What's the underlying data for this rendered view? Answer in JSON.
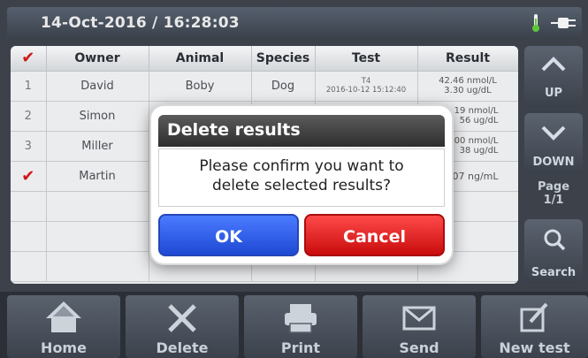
{
  "status_bar": {
    "datetime": "14-Oct-2016 / 16:28:03",
    "icons": [
      "thermometer-icon",
      "power-plug-icon"
    ],
    "thermometer_color": "#5fc63a"
  },
  "table": {
    "headers": [
      "",
      "Owner",
      "Animal",
      "Species",
      "Test",
      "Result"
    ],
    "rows": [
      {
        "num": "1",
        "owner": "David",
        "animal": "Boby",
        "species": "Dog",
        "test_name": "T4",
        "test_time": "2016-10-12 15:12:40",
        "result_1": "42.46 nmol/L",
        "result_2": "3.30 ug/dL",
        "checked": false
      },
      {
        "num": "2",
        "owner": "Simon",
        "animal": "",
        "species": "",
        "test_name": "",
        "test_time": "",
        "result_1": "19 nmol/L",
        "result_2": "56 ug/dL",
        "checked": false
      },
      {
        "num": "3",
        "owner": "Miller",
        "animal": "",
        "species": "",
        "test_name": "",
        "test_time": "",
        "result_1": "00 nmol/L",
        "result_2": "38 ug/dL",
        "checked": false
      },
      {
        "num": "",
        "owner": "Martin",
        "animal": "",
        "species": "",
        "test_name": "",
        "test_time": "",
        "result_1": "07 ng/mL",
        "result_2": "",
        "checked": true
      }
    ],
    "check_mark": "✔"
  },
  "side_buttons": {
    "up_label": "UP",
    "down_label": "DOWN",
    "page_label": "Page",
    "page_value": "1/1",
    "search_label": "Search"
  },
  "bottom_nav": {
    "home": "Home",
    "delete": "Delete",
    "print": "Print",
    "send": "Send",
    "new_test": "New test"
  },
  "dialog": {
    "title": "Delete results",
    "message_line1": "Please confirm you want to",
    "message_line2": "delete selected results?",
    "ok_label": "OK",
    "cancel_label": "Cancel"
  },
  "colors": {
    "check_red": "#d01818",
    "ok_blue": "#2a5cf0",
    "cancel_red": "#e01a1a"
  }
}
